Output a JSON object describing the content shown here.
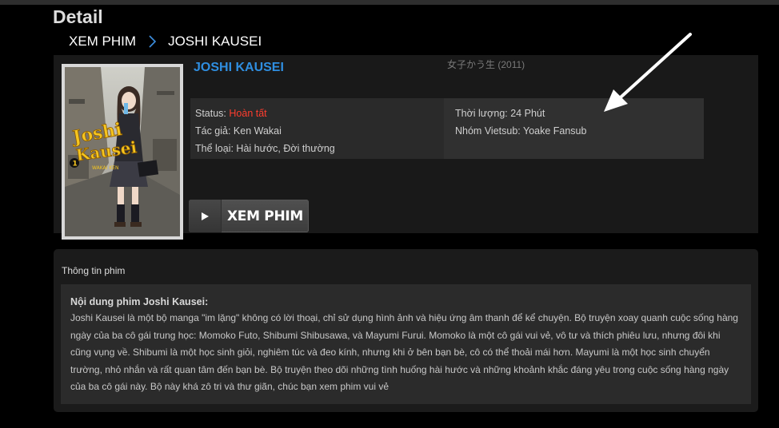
{
  "page": {
    "title": "Detail"
  },
  "breadcrumb": {
    "items": [
      "XEM PHIM",
      "JOSHI KAUSEI"
    ]
  },
  "movie": {
    "title": "JOSHI KAUSEI",
    "original_title": "女子かう生",
    "year": "(2011)",
    "status_label": "Status:",
    "status_value": "Hoàn tất",
    "author": "Tác giả: Ken Wakai",
    "genre": "Thể loại: Hài hước, Đời thường",
    "duration": "Thời lượng: 24 Phút",
    "vietsub_group": "Nhóm Vietsub: Yoake Fansub",
    "watch_button": "XEM PHIM"
  },
  "poster": {
    "logo_line1": "Joshi",
    "logo_line2": "Kausei",
    "logo_author": "WAKAI KEN",
    "volume": "1"
  },
  "synopsis": {
    "heading": "Thông tin phim",
    "title": "Nội dung phim Joshi Kausei:",
    "body": "Joshi Kausei là một bộ manga \"im lặng\" không có lời thoại, chỉ sử dụng hình ảnh và hiệu ứng âm thanh để kể chuyện. Bộ truyện xoay quanh cuộc sống hàng ngày của ba cô gái trung học: Momoko Futo, Shibumi Shibusawa, và Mayumi Furui. Momoko là một cô gái vui vẻ, vô tư và thích phiêu lưu, nhưng đôi khi cũng vụng về. Shibumi là một học sinh giỏi, nghiêm túc và đeo kính, nhưng khi ở bên bạn bè, cô có thể thoải mái hơn. Mayumi là một học sinh chuyển trường, nhỏ nhắn và rất quan tâm đến bạn bè. Bộ truyện theo dõi những tình huống hài hước và những khoảnh khắc đáng yêu trong cuộc sống hàng ngày của ba cô gái này. Bộ này khá zô tri và thư giãn, chúc bạn xem phim vui vẻ"
  },
  "colors": {
    "accent_blue": "#2f8ee0",
    "status_red": "#ff3d2e"
  },
  "icons": [
    "chevron-right-icon",
    "play-icon",
    "annotation-arrow"
  ]
}
